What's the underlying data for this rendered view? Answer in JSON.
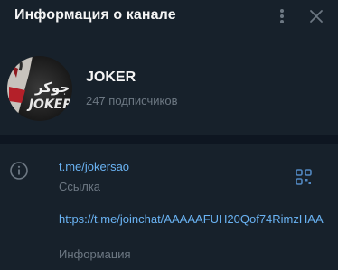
{
  "header": {
    "title": "Информация о канале",
    "menu_icon": "more-vertical-icon",
    "close_icon": "close-icon"
  },
  "channel": {
    "name": "JOKER",
    "subscribers": "247 подписчиков",
    "avatar_text_ar": "جوكر",
    "avatar_text": "JOKER"
  },
  "info": {
    "link": "t.me/jokersao",
    "link_caption": "Ссылка",
    "invite_link": "https://t.me/joinchat/AAAAAFUH20Qof74RimzHAA",
    "invite_caption": "Информация"
  },
  "colors": {
    "background": "#17212b",
    "divider": "#0e1621",
    "link": "#6ab3f3",
    "secondary_text": "#6d7883",
    "accent": "#5288c1"
  }
}
